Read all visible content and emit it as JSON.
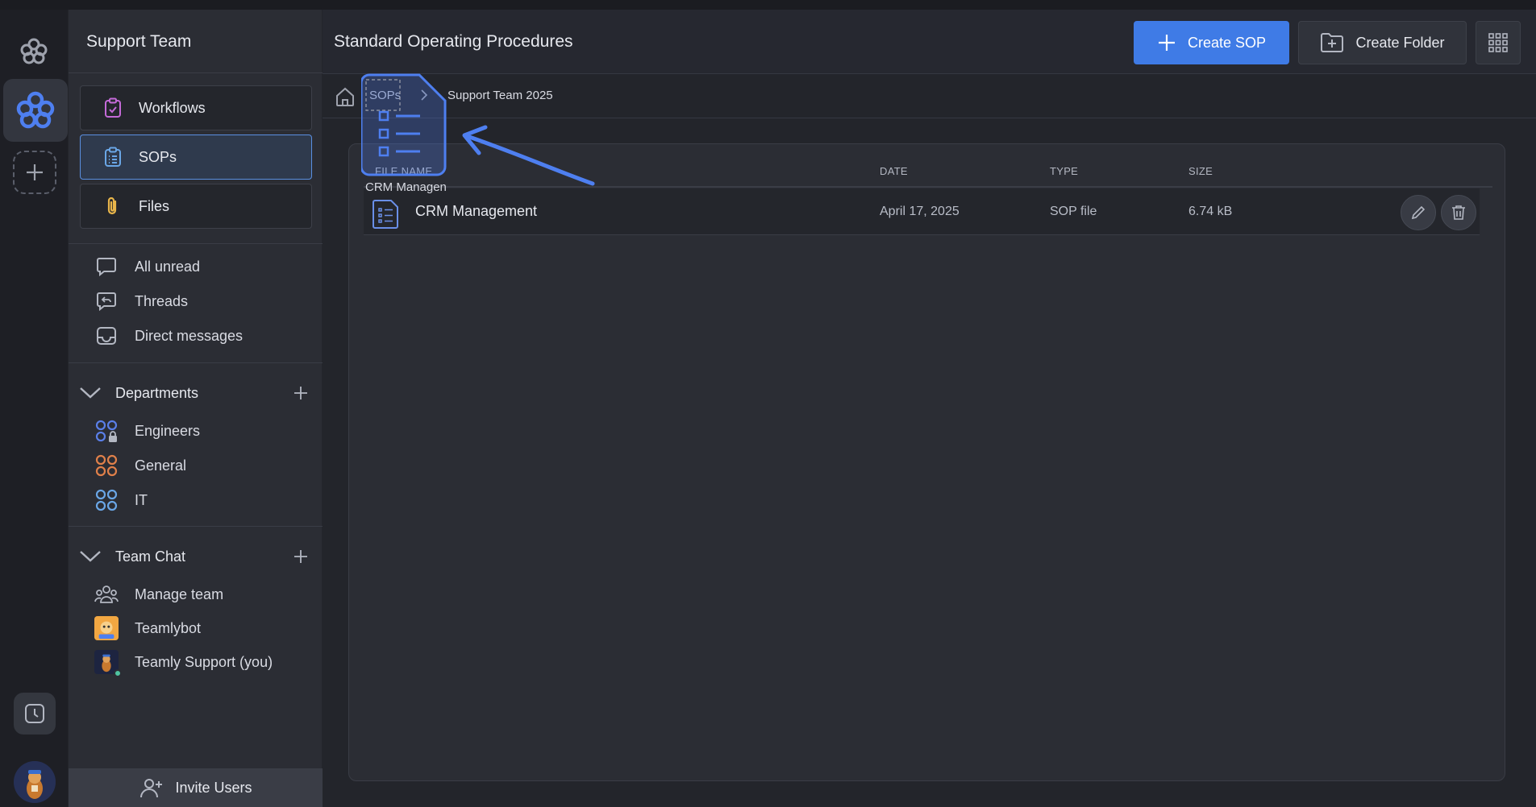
{
  "workspace": {
    "title": "Support Team"
  },
  "sidebar": {
    "nav": [
      {
        "label": "Workflows",
        "icon": "workflow-clipboard-icon"
      },
      {
        "label": "SOPs",
        "icon": "sop-clipboard-icon",
        "active": true
      },
      {
        "label": "Files",
        "icon": "paperclip-icon"
      }
    ],
    "inbox": [
      {
        "label": "All unread",
        "icon": "chat-bubble-icon"
      },
      {
        "label": "Threads",
        "icon": "reply-thread-icon"
      },
      {
        "label": "Direct messages",
        "icon": "inbox-icon"
      }
    ],
    "departments": {
      "label": "Departments",
      "items": [
        {
          "label": "Engineers",
          "icon": "group-lock-icon",
          "color": "#5a7fe8"
        },
        {
          "label": "General",
          "icon": "group-icon",
          "color": "#e0804a"
        },
        {
          "label": "IT",
          "icon": "group-icon",
          "color": "#6aa6e6"
        }
      ]
    },
    "team_chat": {
      "label": "Team Chat",
      "items": [
        {
          "label": "Manage team",
          "icon": "people-icon"
        },
        {
          "label": "Teamlybot",
          "icon": "bot-avatar"
        },
        {
          "label": "Teamly Support (you)",
          "icon": "user-avatar"
        }
      ]
    },
    "invite_label": "Invite Users"
  },
  "main": {
    "title": "Standard Operating Procedures",
    "create_sop_label": "Create SOP",
    "create_folder_label": "Create Folder",
    "breadcrumb": {
      "root": "SOPs",
      "current": "Support Team 2025"
    },
    "table": {
      "columns": [
        "FILE NAME",
        "DATE",
        "TYPE",
        "SIZE"
      ],
      "rows": [
        {
          "name": "CRM Management",
          "date": "April 17, 2025",
          "type": "SOP file",
          "size": "6.74 kB"
        }
      ]
    },
    "drag_ghost_label": "CRM Managen"
  },
  "colors": {
    "accent": "#3f7be6",
    "background": "#23252b",
    "sidebar": "#2b2d34"
  }
}
